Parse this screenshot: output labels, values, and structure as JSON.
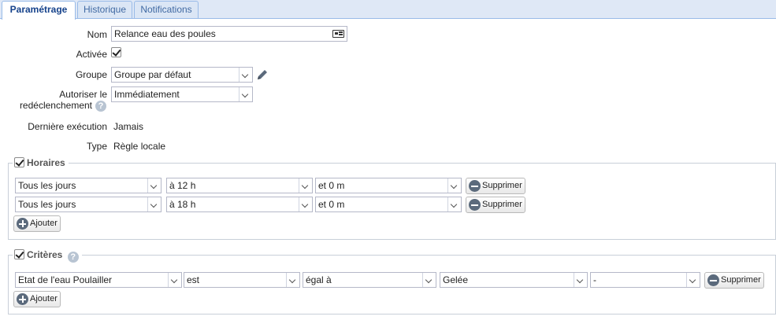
{
  "tabs": [
    {
      "label": "Paramétrage",
      "active": true
    },
    {
      "label": "Historique",
      "active": false
    },
    {
      "label": "Notifications",
      "active": false
    }
  ],
  "form": {
    "nom": {
      "label": "Nom",
      "value": "Relance eau des poules",
      "icon": "card-icon"
    },
    "activee": {
      "label": "Activée",
      "checked": true
    },
    "groupe": {
      "label": "Groupe",
      "value": "Groupe par défaut",
      "icon": "pencil-icon"
    },
    "redeclenchement": {
      "label_line1": "Autoriser le",
      "label_line2": "redéclenchement",
      "value": "Immédiatement"
    },
    "derniere_execution": {
      "label": "Dernière exécution",
      "value": "Jamais"
    },
    "type": {
      "label": "Type",
      "value": "Règle locale"
    }
  },
  "horaires": {
    "legend": "Horaires",
    "checked": true,
    "rows": [
      {
        "jours": "Tous les jours",
        "heure": "à 12 h",
        "minute": "et 0 m",
        "delete_label": "Supprimer"
      },
      {
        "jours": "Tous les jours",
        "heure": "à 18 h",
        "minute": "et 0 m",
        "delete_label": "Supprimer"
      }
    ],
    "add_label": "Ajouter"
  },
  "criteres": {
    "legend": "Critères",
    "checked": true,
    "rows": [
      {
        "sujet": "Etat de l'eau Poulailler",
        "verbe": "est",
        "operateur": "égal à",
        "valeur": "Gelée",
        "extra": "-",
        "delete_label": "Supprimer"
      }
    ],
    "add_label": "Ajouter"
  },
  "colors": {
    "tab_active_text": "#15428b",
    "tab_text": "#416aa3",
    "tabbar_bg": "#dfe8f6",
    "border": "#99bbe8",
    "icon_gray": "#5b6a7c"
  }
}
